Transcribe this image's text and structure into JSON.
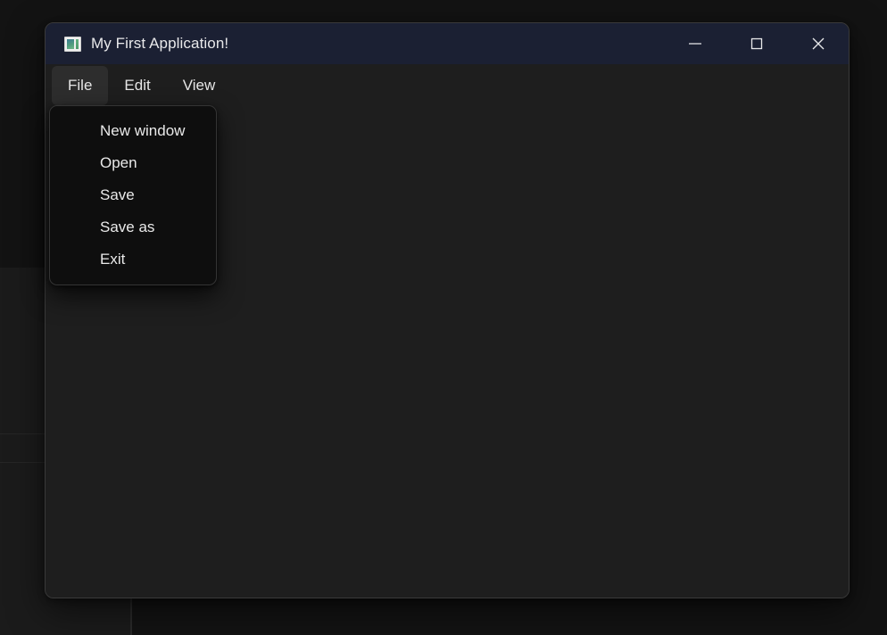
{
  "window": {
    "title": "My First Application!",
    "icon": "application-window-icon",
    "colors": {
      "titlebar": "#1b2033",
      "body": "#1e1e1e",
      "menu_highlight": "#2d2d2d",
      "dropdown": "#0e0e0e",
      "border": "#3a3a3a",
      "text": "#e8e8ea",
      "desktop": "#131313"
    },
    "controls": [
      {
        "name": "minimize-button",
        "icon": "minimize-icon",
        "label": "Minimize"
      },
      {
        "name": "maximize-button",
        "icon": "maximize-icon",
        "label": "Maximize"
      },
      {
        "name": "close-button",
        "icon": "close-icon",
        "label": "Close"
      }
    ]
  },
  "menubar": {
    "items": [
      {
        "label": "File",
        "active": true
      },
      {
        "label": "Edit",
        "active": false
      },
      {
        "label": "View",
        "active": false
      }
    ]
  },
  "file_menu": {
    "open": true,
    "items": [
      {
        "label": "New window"
      },
      {
        "label": "Open"
      },
      {
        "label": "Save"
      },
      {
        "label": "Save as"
      },
      {
        "label": "Exit"
      }
    ]
  },
  "client_area": {
    "content": ""
  }
}
